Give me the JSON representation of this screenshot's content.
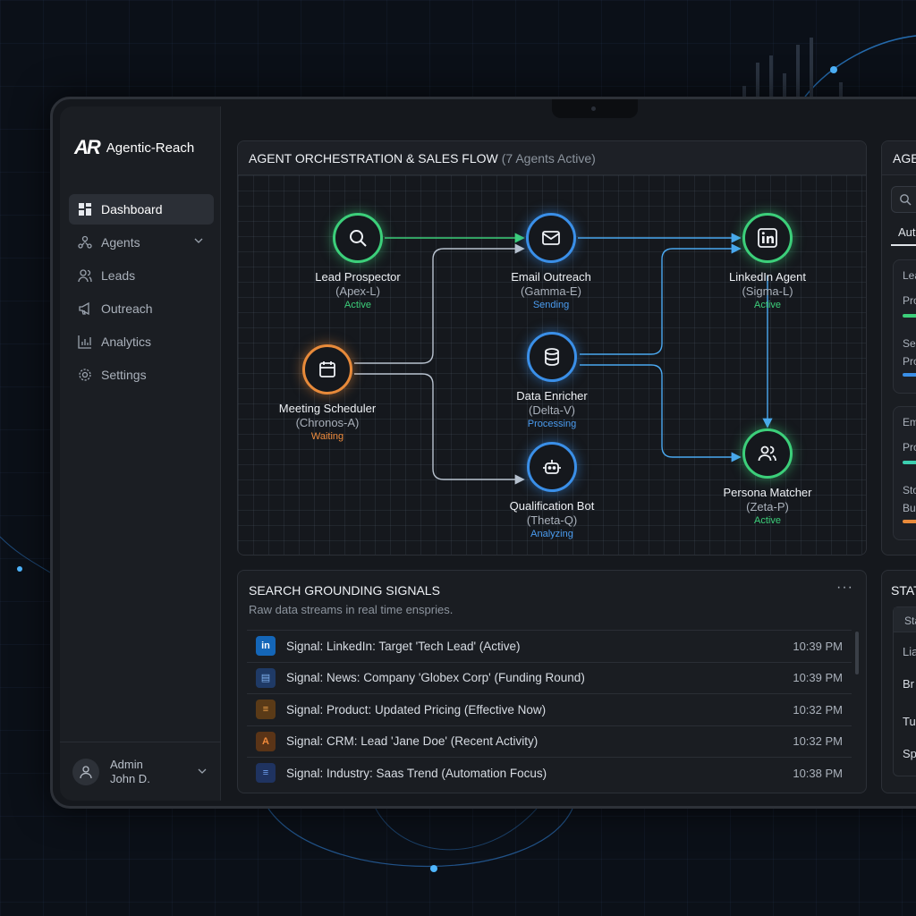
{
  "app": {
    "logo_mark": "AR",
    "name": "Agentic-Reach"
  },
  "sidebar": {
    "items": [
      {
        "label": "Dashboard",
        "icon": "grid-icon",
        "active": true
      },
      {
        "label": "Agents",
        "icon": "agents-icon",
        "expandable": true
      },
      {
        "label": "Leads",
        "icon": "users-icon"
      },
      {
        "label": "Outreach",
        "icon": "megaphone-icon"
      },
      {
        "label": "Analytics",
        "icon": "bar-chart-icon"
      },
      {
        "label": "Settings",
        "icon": "gear-icon"
      }
    ],
    "user": {
      "role": "Admin",
      "name": "John D."
    }
  },
  "flow": {
    "title": "AGENT ORCHESTRATION & SALES FLOW",
    "subtitle": "(7 Agents Active)",
    "nodes": [
      {
        "name": "Lead Prospector",
        "id": "(Apex-L)",
        "status": "Active",
        "icon": "search-icon",
        "color": "#3ccf7a"
      },
      {
        "name": "Email Outreach",
        "id": "(Gamma-E)",
        "status": "Sending",
        "icon": "mail-icon",
        "color": "#3a8fe8"
      },
      {
        "name": "LinkedIn Agent",
        "id": "(Sigma-L)",
        "status": "Active",
        "icon": "linkedin-icon",
        "color": "#3ccf7a"
      },
      {
        "name": "Meeting Scheduler",
        "id": "(Chronos-A)",
        "status": "Waiting",
        "icon": "calendar-icon",
        "color": "#e88a3a"
      },
      {
        "name": "Data Enricher",
        "id": "(Delta-V)",
        "status": "Processing",
        "icon": "database-icon",
        "color": "#3a8fe8"
      },
      {
        "name": "Qualification Bot",
        "id": "(Theta-Q)",
        "status": "Analyzing",
        "icon": "bot-icon",
        "color": "#3a8fe8"
      },
      {
        "name": "Persona Matcher",
        "id": "(Zeta-P)",
        "status": "Active",
        "icon": "persona-icon",
        "color": "#3ccf7a"
      }
    ]
  },
  "signals": {
    "title": "SEARCH GROUNDING SIGNALS",
    "subtitle": "Raw data streams in real time enspries.",
    "more": "···",
    "rows": [
      {
        "icon_label": "in",
        "text": "Signal: LinkedIn: Target 'Tech Lead' (Active)",
        "time": "10:39 PM",
        "icon": "linkedin-icon"
      },
      {
        "icon_label": "▤",
        "text": "Signal: News: Company 'Globex Corp' (Funding Round)",
        "time": "10:39 PM",
        "icon": "news-icon"
      },
      {
        "icon_label": "≡",
        "text": "Signal: Product: Updated Pricing (Effective Now)",
        "time": "10:32 PM",
        "icon": "database-icon"
      },
      {
        "icon_label": "A",
        "text": "Signal: CRM: Lead 'Jane Doe' (Recent Activity)",
        "time": "10:32 PM",
        "icon": "crm-icon"
      },
      {
        "icon_label": "≡",
        "text": "Signal: Industry: Saas Trend (Automation Focus)",
        "time": "10:38 PM",
        "icon": "document-icon"
      }
    ]
  },
  "right_panel_top": {
    "title": "AGE",
    "tab": "Aut",
    "card1_lines": [
      "Lea",
      "Pro",
      "Sei",
      "Pro"
    ],
    "card2_lines": [
      "Em",
      "Pro",
      "Sto",
      "Bui"
    ]
  },
  "right_panel_bottom": {
    "title": "STAT",
    "header": "Sta",
    "rows": [
      "Lia",
      "Br",
      "Tu",
      "Sp"
    ]
  }
}
